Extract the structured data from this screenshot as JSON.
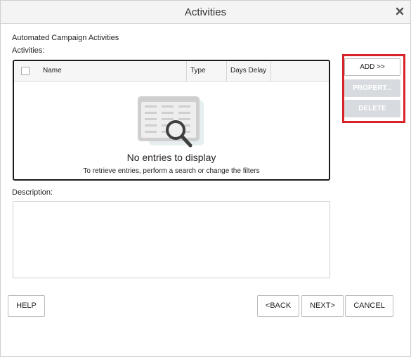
{
  "dialog": {
    "title": "Activities",
    "close_icon": "close-icon"
  },
  "form": {
    "section_title": "Automated Campaign Activities",
    "activities_label": "Activities:",
    "description_label": "Description:",
    "description_value": ""
  },
  "grid": {
    "columns": [
      "Name",
      "Type",
      "Days Delay"
    ],
    "empty_title": "No entries to display",
    "empty_subtitle": "To retrieve entries, perform a search or change the filters",
    "empty_icon": "empty-search-icon"
  },
  "side_buttons": {
    "add": "ADD >>",
    "properties": "PROPERT...",
    "delete": "DELETE"
  },
  "footer": {
    "help": "HELP",
    "back": "<BACK",
    "next": "NEXT>",
    "cancel": "CANCEL"
  },
  "colors": {
    "highlight_border": "#d9232b",
    "disabled_button": "#d7dbe0"
  }
}
